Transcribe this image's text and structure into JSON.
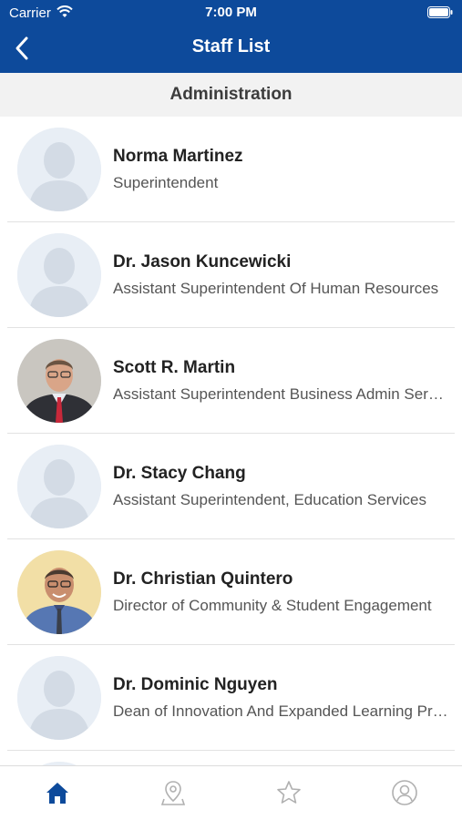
{
  "status_bar": {
    "carrier": "Carrier",
    "time": "7:00 PM"
  },
  "nav": {
    "title": "Staff List"
  },
  "section": {
    "title": "Administration"
  },
  "staff": [
    {
      "name": "Norma Martinez",
      "title": "Superintendent",
      "avatar": "placeholder"
    },
    {
      "name": "Dr. Jason Kuncewicki",
      "title": "Assistant Superintendent Of Human Resources",
      "avatar": "placeholder"
    },
    {
      "name": "Scott R. Martin",
      "title": "Assistant Superintendent Business Admin Services",
      "avatar": "photo-suit"
    },
    {
      "name": "Dr. Stacy Chang",
      "title": "Assistant Superintendent, Education Services",
      "avatar": "placeholder"
    },
    {
      "name": "Dr. Christian Quintero",
      "title": "Director of Community & Student Engagement",
      "avatar": "photo-shirt"
    },
    {
      "name": "Dr. Dominic Nguyen",
      "title": "Dean of Innovation And Expanded Learning Programs",
      "avatar": "placeholder"
    }
  ],
  "tabs": [
    {
      "icon": "home-icon",
      "active": true
    },
    {
      "icon": "map-pin-icon",
      "active": false
    },
    {
      "icon": "star-icon",
      "active": false
    },
    {
      "icon": "profile-icon",
      "active": false
    }
  ],
  "colors": {
    "brand": "#0d4a9b",
    "inactive_tab": "#b0b0b0"
  }
}
